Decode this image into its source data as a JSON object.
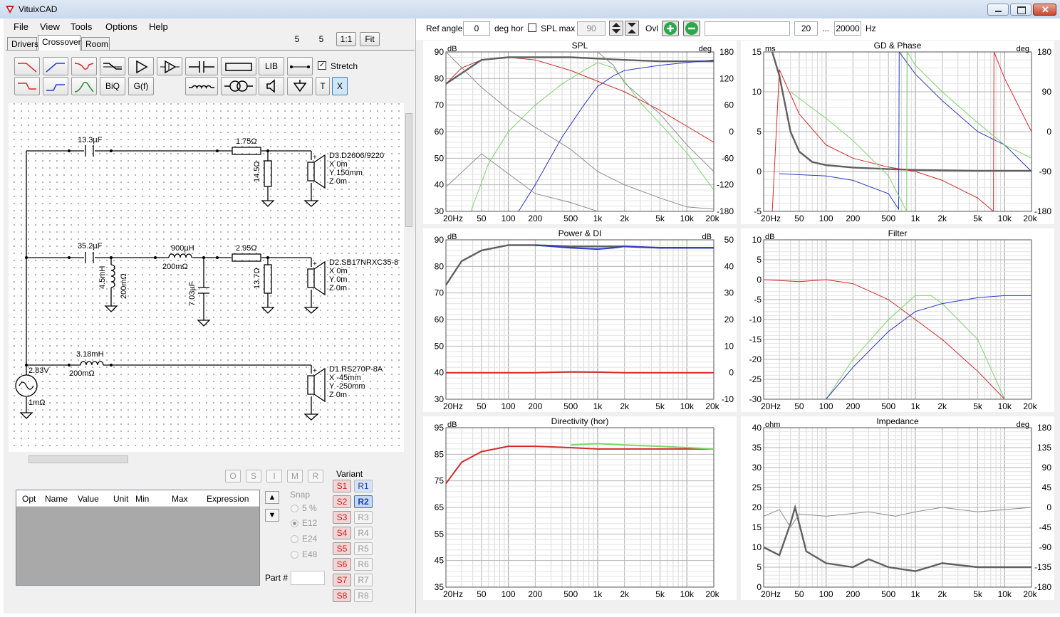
{
  "app": {
    "title": "VituixCAD"
  },
  "menu": [
    "File",
    "View",
    "Tools",
    "Options",
    "Help"
  ],
  "tabs": [
    "Drivers",
    "Crossover",
    "Room"
  ],
  "zoom_inputs": [
    "5",
    "5"
  ],
  "zoom_buttons": [
    "1:1",
    "Fit"
  ],
  "toolbar_left": {
    "lib": "LIB",
    "biq": "BiQ",
    "gf": "G(f)",
    "t": "T",
    "x": "X",
    "stretch": "Stretch"
  },
  "schematic_labels": {
    "c1": "13.3µF",
    "r1": "1.75Ω",
    "r2": "14.5Ω",
    "d3_name": "D3.D2606/9220",
    "d3_x": "X 0m",
    "d3_y": "Y 150mm",
    "d3_z": "Z 0m",
    "c2": "35.2µF",
    "l1": "4.5mH",
    "l1r": "200mΩ",
    "l2": "900µH",
    "l2r": "200mΩ",
    "c3": "7.03µF",
    "r3": "2.95Ω",
    "r4": "13.7Ω",
    "d2_name": "D2.SB17NRXC35-8",
    "d2_x": "X 0m",
    "d2_y": "Y 0m",
    "d2_z": "Z 0m",
    "l3": "3.18mH",
    "l3r": "200mΩ",
    "src_v": "2.83V",
    "src_r": "1mΩ",
    "d1_name": "D1.RS270P-8A",
    "d1_x": "X -45mm",
    "d1_y": "Y -250mm",
    "d1_z": "Z 0m"
  },
  "omsimr": [
    "O",
    "S",
    "I",
    "M",
    "R"
  ],
  "variant": {
    "label": "Variant",
    "s": [
      "S1",
      "S2",
      "S3",
      "S4",
      "S5",
      "S6",
      "S7",
      "S8"
    ],
    "r": [
      "R1",
      "R2",
      "R3",
      "R4",
      "R5",
      "R6",
      "R7",
      "R8"
    ],
    "active": "R2"
  },
  "snap": {
    "label": "Snap",
    "options": [
      "5 %",
      "E12",
      "E24",
      "E48"
    ],
    "selected": "E12"
  },
  "part_label": "Part #",
  "opt_columns": [
    "Opt",
    "Name",
    "Value",
    "Unit",
    "Min",
    "Max",
    "Expression"
  ],
  "top_toolbar": {
    "ref_angle_label": "Ref angle",
    "ref_angle": "0",
    "deg_hor": "deg hor",
    "spl_max_label": "SPL max",
    "spl_max": "90",
    "ovl": "Ovl",
    "range_from": "20",
    "ellipsis": "...",
    "range_to": "20000",
    "hz": "Hz"
  },
  "colors": {
    "red": "#d42a2a",
    "blue": "#2a3bc2",
    "green": "#7cd46a",
    "grey": "#8e8e8e",
    "dark": "#606060"
  },
  "chart_data": [
    {
      "type": "line",
      "title": "SPL",
      "ylabel": "dB",
      "y2label": "deg",
      "xscale": "log",
      "x_ticks": [
        "20Hz",
        "50",
        "100",
        "200",
        "500",
        "1k",
        "2k",
        "5k",
        "10k",
        "20k"
      ],
      "y_ticks": [
        "90",
        "80",
        "70",
        "60",
        "50",
        "40",
        "30"
      ],
      "y2_ticks": [
        "180",
        "120",
        "60",
        "0",
        "-60",
        "-120",
        "-180"
      ],
      "ylim": [
        30,
        90
      ],
      "y2lim": [
        -180,
        180
      ],
      "series": [
        {
          "color": "red",
          "x": [
            20,
            30,
            50,
            100,
            200,
            500,
            1000,
            2000,
            5000,
            10000,
            20000
          ],
          "y": [
            78,
            84,
            87,
            88,
            87,
            83,
            79,
            75,
            68,
            62,
            56
          ]
        },
        {
          "color": "dark",
          "x": [
            20,
            50,
            100,
            200,
            500,
            1000,
            2000,
            5000,
            20000
          ],
          "y": [
            78,
            87,
            88,
            88,
            88,
            87.5,
            87,
            86.5,
            86.5
          ]
        },
        {
          "color": "green",
          "x": [
            38,
            60,
            100,
            200,
            400,
            700,
            1000,
            1500,
            2000,
            3000,
            5000,
            10000,
            20000
          ],
          "y": [
            30,
            48,
            60,
            70,
            78,
            83,
            86,
            84,
            79,
            71,
            63,
            52,
            38
          ]
        },
        {
          "color": "blue",
          "x": [
            130,
            200,
            400,
            700,
            1000,
            1500,
            2000,
            5000,
            10000,
            20000
          ],
          "y": [
            30,
            40,
            58,
            70,
            77,
            81,
            83,
            85,
            86,
            87
          ]
        },
        {
          "color": "grey",
          "axis": "y2",
          "x": [
            20,
            50,
            100,
            200,
            500,
            1000
          ],
          "y": [
            -125,
            -50,
            -95,
            -140,
            -160,
            -180
          ]
        },
        {
          "color": "grey",
          "axis": "y2",
          "x": [
            20,
            50,
            100,
            200,
            500,
            1000,
            2000,
            5000,
            10000,
            20000
          ],
          "y": [
            180,
            100,
            50,
            10,
            -40,
            -90,
            -120,
            -150,
            -170,
            -175
          ]
        },
        {
          "color": "grey",
          "axis": "y2",
          "x": [
            1000,
            1500,
            2000,
            5000,
            10000,
            20000
          ],
          "y": [
            180,
            150,
            110,
            40,
            -30,
            -90
          ]
        }
      ]
    },
    {
      "type": "line",
      "title": "GD & Phase",
      "ylabel": "ms",
      "y2label": "deg",
      "xscale": "log",
      "x_ticks": [
        "20Hz",
        "50",
        "100",
        "200",
        "500",
        "1k",
        "2k",
        "5k",
        "10k",
        "20k"
      ],
      "y_ticks": [
        "15",
        "10",
        "5",
        "0",
        "-5"
      ],
      "y2_ticks": [
        "180",
        "90",
        "0",
        "-90",
        "-180"
      ],
      "ylim": [
        -5,
        15
      ],
      "y2lim": [
        -180,
        180
      ],
      "series": [
        {
          "color": "dark",
          "x": [
            25,
            30,
            40,
            50,
            70,
            100,
            200,
            500,
            1000,
            2000,
            5000,
            10000,
            20000
          ],
          "y": [
            15,
            12,
            5,
            2.5,
            1.2,
            0.8,
            0.5,
            0.3,
            0.2,
            0.15,
            0.1,
            0.1,
            0.1
          ]
        },
        {
          "color": "red",
          "axis": "y2",
          "x": [
            25,
            30,
            50,
            100,
            200,
            500,
            1000,
            2000,
            5000,
            7500,
            7600,
            10000,
            20000
          ],
          "y": [
            -180,
            140,
            40,
            -30,
            -60,
            -80,
            -90,
            -110,
            -150,
            -180,
            180,
            120,
            0
          ]
        },
        {
          "color": "blue",
          "axis": "y2",
          "x": [
            30,
            100,
            200,
            500,
            650,
            660,
            1000,
            2000,
            5000,
            10000,
            20000
          ],
          "y": [
            -95,
            -100,
            -110,
            -140,
            -175,
            180,
            130,
            70,
            0,
            -30,
            -90
          ]
        },
        {
          "color": "green",
          "axis": "y2",
          "x": [
            40,
            100,
            200,
            500,
            800,
            810,
            1000,
            2000,
            5000,
            10000,
            20000
          ],
          "y": [
            90,
            30,
            -20,
            -100,
            -180,
            180,
            150,
            90,
            20,
            -30,
            -60
          ]
        }
      ]
    },
    {
      "type": "line",
      "title": "Power & DI",
      "ylabel": "dB",
      "y2label": "dB",
      "xscale": "log",
      "x_ticks": [
        "20Hz",
        "50",
        "100",
        "200",
        "500",
        "1k",
        "2k",
        "5k",
        "10k",
        "20k"
      ],
      "y_ticks": [
        "90",
        "80",
        "70",
        "60",
        "50",
        "40",
        "30"
      ],
      "y2_ticks": [
        "50",
        "40",
        "30",
        "20",
        "10",
        "0",
        "-10"
      ],
      "ylim": [
        30,
        90
      ],
      "y2lim": [
        -10,
        50
      ],
      "series": [
        {
          "color": "dark",
          "x": [
            20,
            30,
            50,
            100,
            200,
            500,
            1000,
            2000,
            5000,
            20000
          ],
          "y": [
            73,
            82,
            86,
            88,
            88,
            87.5,
            87.5,
            87.5,
            87,
            87
          ]
        },
        {
          "color": "blue",
          "x": [
            200,
            500,
            1000,
            1500,
            2000,
            5000,
            20000
          ],
          "y": [
            88,
            87,
            86.5,
            87,
            87.5,
            87,
            87
          ]
        },
        {
          "color": "red",
          "axis": "y2",
          "x": [
            20,
            100,
            200,
            500,
            1000,
            2000,
            5000,
            20000
          ],
          "y": [
            0,
            0,
            0,
            0.3,
            0.2,
            0,
            0,
            0
          ]
        }
      ]
    },
    {
      "type": "line",
      "title": "Filter",
      "ylabel": "dB",
      "xscale": "log",
      "x_ticks": [
        "20Hz",
        "50",
        "100",
        "200",
        "500",
        "1k",
        "2k",
        "5k",
        "10k",
        "20k"
      ],
      "y_ticks": [
        "10",
        "5",
        "0",
        "-5",
        "-10",
        "-15",
        "-20",
        "-25",
        "-30"
      ],
      "ylim": [
        -30,
        10
      ],
      "series": [
        {
          "color": "red",
          "x": [
            20,
            50,
            100,
            200,
            500,
            1000,
            2000,
            5000,
            10000
          ],
          "y": [
            0,
            -0.5,
            0,
            -1,
            -5,
            -10,
            -15,
            -23,
            -30
          ]
        },
        {
          "color": "green",
          "x": [
            100,
            200,
            500,
            1000,
            1500,
            2000,
            5000,
            10000
          ],
          "y": [
            -30,
            -20,
            -10,
            -4,
            -4,
            -6,
            -15,
            -30
          ]
        },
        {
          "color": "blue",
          "x": [
            100,
            200,
            500,
            1000,
            2000,
            5000,
            10000,
            20000
          ],
          "y": [
            -30,
            -22,
            -13,
            -8,
            -6,
            -4.5,
            -4,
            -4
          ]
        }
      ]
    },
    {
      "type": "line",
      "title": "Directivity (hor)",
      "ylabel": "dB",
      "xscale": "log",
      "x_ticks": [
        "20Hz",
        "50",
        "100",
        "200",
        "500",
        "1k",
        "2k",
        "5k",
        "10k",
        "20k"
      ],
      "y_ticks": [
        "95",
        "85",
        "75",
        "65",
        "55",
        "45",
        "35"
      ],
      "ylim": [
        35,
        95
      ],
      "series": [
        {
          "color": "red",
          "x": [
            20,
            30,
            50,
            100,
            200,
            500,
            1000,
            2000,
            5000,
            20000
          ],
          "y": [
            74,
            82,
            86,
            88,
            88,
            87.5,
            87,
            87,
            87,
            87
          ]
        },
        {
          "color": "green",
          "x": [
            500,
            1000,
            2000,
            5000,
            20000
          ],
          "y": [
            88.5,
            89,
            88.5,
            88,
            87
          ]
        }
      ]
    },
    {
      "type": "line",
      "title": "Impedance",
      "ylabel": "ohm",
      "y2label": "deg",
      "xscale": "log",
      "x_ticks": [
        "20Hz",
        "50",
        "100",
        "200",
        "500",
        "1k",
        "2k",
        "5k",
        "10k",
        "20k"
      ],
      "y_ticks": [
        "40",
        "35",
        "30",
        "25",
        "20",
        "15",
        "10",
        "5",
        "0"
      ],
      "y2_ticks": [
        "180",
        "135",
        "90",
        "45",
        "0",
        "-45",
        "-90",
        "-135",
        "-180"
      ],
      "ylim": [
        0,
        40
      ],
      "y2lim": [
        -180,
        180
      ],
      "series": [
        {
          "color": "dark",
          "x": [
            20,
            30,
            40,
            45,
            60,
            100,
            200,
            300,
            500,
            1000,
            2000,
            5000,
            20000
          ],
          "y": [
            10,
            8,
            16,
            20,
            9,
            6,
            5,
            7,
            5,
            4,
            6,
            5,
            5
          ]
        },
        {
          "color": "grey",
          "axis": "y2",
          "x": [
            20,
            30,
            40,
            50,
            100,
            300,
            600,
            1000,
            2000,
            5000,
            20000
          ],
          "y": [
            -20,
            -5,
            -45,
            -15,
            -20,
            -10,
            -20,
            -10,
            0,
            -10,
            0
          ]
        }
      ]
    }
  ]
}
